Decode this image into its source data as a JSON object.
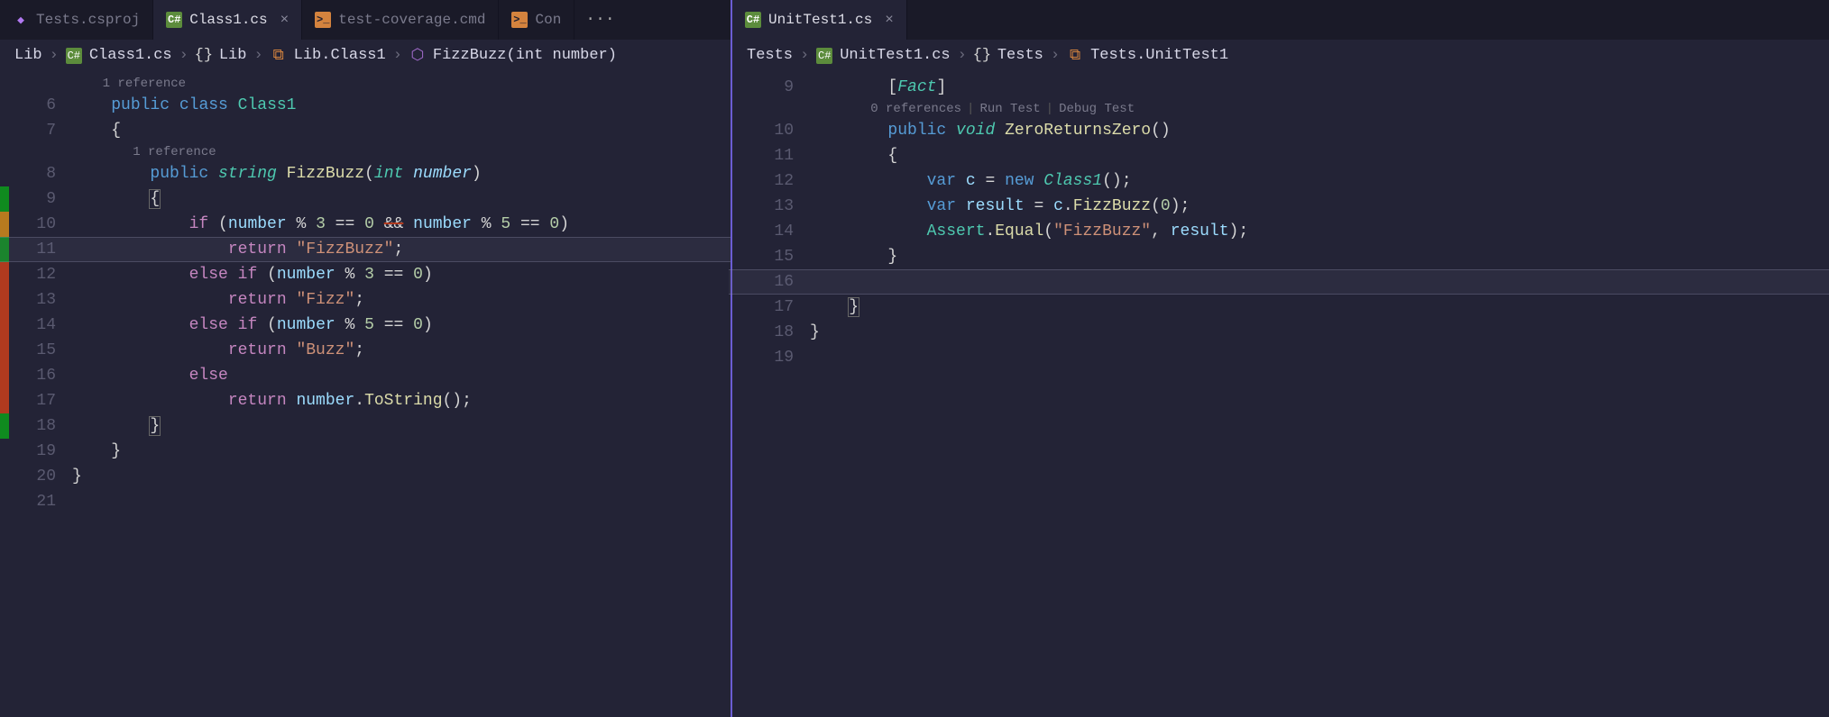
{
  "left": {
    "tabs": [
      {
        "icon": "vs",
        "label": "Tests.csproj",
        "active": false
      },
      {
        "icon": "cs",
        "label": "Class1.cs",
        "active": true
      },
      {
        "icon": "cmd",
        "label": "test-coverage.cmd",
        "active": false
      },
      {
        "icon": "cmd",
        "label": "Con",
        "active": false
      }
    ],
    "overflow": "···",
    "breadcrumb": {
      "parts": [
        "Lib",
        "Class1.cs",
        "Lib",
        "Lib.Class1",
        "FizzBuzz(int number)"
      ]
    },
    "codelens1": "1 reference",
    "codelens2": "1 reference",
    "line_start": 6,
    "lines": {
      "6": {
        "html": "    <span class='tok-mod'>public</span> <span class='tok-mod'>class</span> <span class='tok-type-nf'>Class1</span>",
        "cov": "none"
      },
      "7": {
        "html": "    {",
        "cov": "none"
      },
      "8": {
        "html": "        <span class='tok-mod'>public</span> <span class='tok-type'>string</span> <span class='tok-method'>FizzBuzz</span>(<span class='tok-type'>int</span> <span class='tok-param'>number</span>)",
        "cov": "none"
      },
      "9": {
        "html": "        <span class='brace-box'>{</span>",
        "cov": "green"
      },
      "10": {
        "html": "            <span class='tok-kw'>if</span> (<span class='tok-var'>number</span> % <span class='tok-num'>3</span> == <span class='tok-num'>0</span> <span class='strike'>&amp;&amp;</span> <span class='tok-var'>number</span> % <span class='tok-num'>5</span> == <span class='tok-num'>0</span>)",
        "cov": "orange"
      },
      "11": {
        "html": "                <span class='tok-kw'>return</span> <span class='tok-str'>\"FizzBuzz\"</span>;",
        "cov": "green",
        "highlight": true
      },
      "12": {
        "html": "            <span class='tok-kw'>else</span> <span class='tok-kw'>if</span> (<span class='tok-var'>number</span> % <span class='tok-num'>3</span> == <span class='tok-num'>0</span>)",
        "cov": "red"
      },
      "13": {
        "html": "                <span class='tok-kw'>return</span> <span class='tok-str'>\"Fizz\"</span>;",
        "cov": "red"
      },
      "14": {
        "html": "            <span class='tok-kw'>else</span> <span class='tok-kw'>if</span> (<span class='tok-var'>number</span> % <span class='tok-num'>5</span> == <span class='tok-num'>0</span>)",
        "cov": "red"
      },
      "15": {
        "html": "                <span class='tok-kw'>return</span> <span class='tok-str'>\"Buzz\"</span>;",
        "cov": "red"
      },
      "16": {
        "html": "            <span class='tok-kw'>else</span>",
        "cov": "red"
      },
      "17": {
        "html": "                <span class='tok-kw'>return</span> <span class='tok-var'>number</span>.<span class='tok-method'>ToString</span>();",
        "cov": "red"
      },
      "18": {
        "html": "        <span class='brace-box'>}</span>",
        "cov": "green"
      },
      "19": {
        "html": "    }",
        "cov": "none"
      },
      "20": {
        "html": "}",
        "cov": "none"
      },
      "21": {
        "html": "",
        "cov": "none"
      }
    }
  },
  "right": {
    "tabs": [
      {
        "icon": "cs",
        "label": "UnitTest1.cs",
        "active": true
      }
    ],
    "breadcrumb": {
      "parts": [
        "Tests",
        "UnitTest1.cs",
        "Tests",
        "Tests.UnitTest1"
      ]
    },
    "codelens": {
      "refs": "0 references",
      "run": "Run Test",
      "debug": "Debug Test"
    },
    "line_start": 9,
    "lines": {
      "9": {
        "html": "        [<span class='tok-attr'>Fact</span>]"
      },
      "10": {
        "html": "        <span class='tok-mod'>public</span> <span class='tok-type'>void</span> <span class='tok-method'>ZeroReturnsZero</span>()"
      },
      "11": {
        "html": "        {"
      },
      "12": {
        "html": "            <span class='tok-mod'>var</span> <span class='tok-var'>c</span> = <span class='tok-mod'>new</span> <span class='tok-type'>Class1</span>();"
      },
      "13": {
        "html": "            <span class='tok-mod'>var</span> <span class='tok-var'>result</span> = <span class='tok-var'>c</span>.<span class='tok-method'>FizzBuzz</span>(<span class='tok-num'>0</span>);"
      },
      "14": {
        "html": "            <span class='tok-type-nf'>Assert</span>.<span class='tok-method'>Equal</span>(<span class='tok-str'>\"FizzBuzz\"</span>, <span class='tok-var'>result</span>);"
      },
      "15": {
        "html": "        }"
      },
      "16": {
        "html": "",
        "highlight": true
      },
      "17": {
        "html": "    <span class='matchbox'>}</span>"
      },
      "18": {
        "html": "}"
      },
      "19": {
        "html": ""
      }
    }
  }
}
